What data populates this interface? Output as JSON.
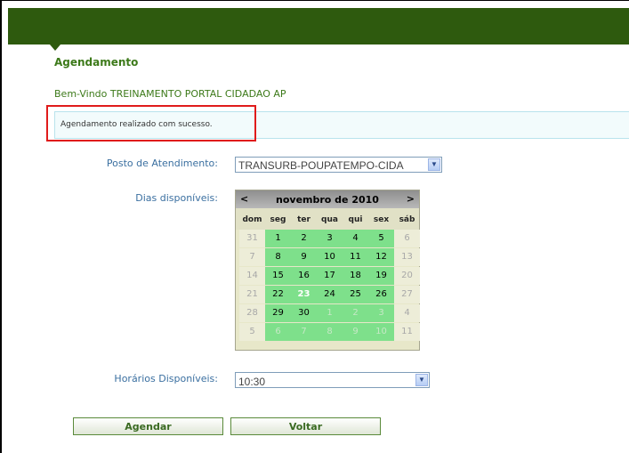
{
  "page": {
    "title": "Agendamento",
    "welcome": "Bem-Vindo TREINAMENTO PORTAL CIDADAO AP",
    "success_message": "Agendamento realizado com sucesso."
  },
  "form": {
    "posto_label": "Posto de Atendimento:",
    "posto_value": "TRANSURB-POUPATEMPO-CIDA",
    "dias_label": "Dias disponíveis:",
    "horarios_label": "Horários Disponíveis:",
    "horarios_value": "10:30"
  },
  "calendar": {
    "prev": "<",
    "next": ">",
    "title": "novembro de 2010",
    "weekdays": [
      "dom",
      "seg",
      "ter",
      "qua",
      "qui",
      "sex",
      "sáb"
    ],
    "weeks": [
      [
        {
          "d": "31",
          "s": "out"
        },
        {
          "d": "1",
          "s": "avail"
        },
        {
          "d": "2",
          "s": "avail"
        },
        {
          "d": "3",
          "s": "avail"
        },
        {
          "d": "4",
          "s": "avail"
        },
        {
          "d": "5",
          "s": "avail"
        },
        {
          "d": "6",
          "s": "out"
        }
      ],
      [
        {
          "d": "7",
          "s": "out"
        },
        {
          "d": "8",
          "s": "avail"
        },
        {
          "d": "9",
          "s": "avail"
        },
        {
          "d": "10",
          "s": "avail"
        },
        {
          "d": "11",
          "s": "avail"
        },
        {
          "d": "12",
          "s": "avail"
        },
        {
          "d": "13",
          "s": "out"
        }
      ],
      [
        {
          "d": "14",
          "s": "out"
        },
        {
          "d": "15",
          "s": "avail"
        },
        {
          "d": "16",
          "s": "avail"
        },
        {
          "d": "17",
          "s": "avail"
        },
        {
          "d": "18",
          "s": "avail"
        },
        {
          "d": "19",
          "s": "avail"
        },
        {
          "d": "20",
          "s": "out"
        }
      ],
      [
        {
          "d": "21",
          "s": "out"
        },
        {
          "d": "22",
          "s": "avail"
        },
        {
          "d": "23",
          "s": "sel"
        },
        {
          "d": "24",
          "s": "avail"
        },
        {
          "d": "25",
          "s": "avail"
        },
        {
          "d": "26",
          "s": "avail"
        },
        {
          "d": "27",
          "s": "out"
        }
      ],
      [
        {
          "d": "28",
          "s": "out"
        },
        {
          "d": "29",
          "s": "avail"
        },
        {
          "d": "30",
          "s": "avail"
        },
        {
          "d": "1",
          "s": "unavail"
        },
        {
          "d": "2",
          "s": "unavail"
        },
        {
          "d": "3",
          "s": "unavail"
        },
        {
          "d": "4",
          "s": "out"
        }
      ],
      [
        {
          "d": "5",
          "s": "out"
        },
        {
          "d": "6",
          "s": "unavail"
        },
        {
          "d": "7",
          "s": "unavail"
        },
        {
          "d": "8",
          "s": "unavail"
        },
        {
          "d": "9",
          "s": "unavail"
        },
        {
          "d": "10",
          "s": "unavail"
        },
        {
          "d": "11",
          "s": "out"
        }
      ]
    ]
  },
  "buttons": {
    "agendar": "Agendar",
    "voltar": "Voltar"
  },
  "icons": {
    "select_arrow": "chevron-down-icon",
    "header_marker": "arrow-down-icon"
  },
  "colors": {
    "header": "#2e5a0e",
    "title": "#3d7a1a",
    "label": "#3a6fa0",
    "available_day": "#7ee08b",
    "highlight": "#e01b1b"
  }
}
